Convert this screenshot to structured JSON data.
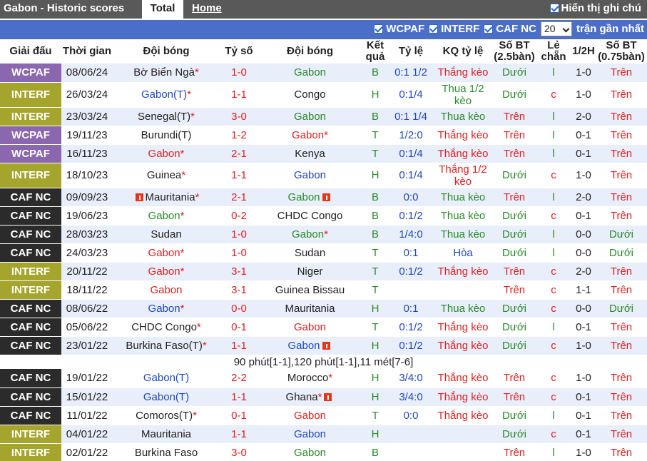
{
  "topbar": {
    "title": "Gabon - Historic scores",
    "tab_total": "Total",
    "tab_home": "Home",
    "toggle_label": "Hiển thị ghi chú"
  },
  "filters": {
    "items": [
      "WCPAF",
      "INTERF",
      "CAF NC"
    ],
    "count_value": "20",
    "recent_label": "trận gần nhất"
  },
  "columns": [
    "Giải đấu",
    "Thời gian",
    "Đội bóng",
    "Tỷ số",
    "Đội bóng",
    "Kết quả",
    "Tỷ lệ",
    "KQ tỷ lệ",
    "Số BT (2.5bàn)",
    "Lẻ chẵn",
    "1/2H",
    "Số BT (0.75bàn)"
  ],
  "colors": {
    "WCPAF": "#8b67b0",
    "INTERF": "#a5a42c",
    "CAF NC": "#2b2b2b",
    "red": "#e02020",
    "green": "#2a8a2a",
    "blue": "#1f49c0"
  },
  "rows": [
    {
      "league": "WCPAF",
      "date": "08/06/24",
      "home": "Bờ Biển Ngà",
      "home_star": true,
      "home_color": "",
      "score": "1-0",
      "away": "Gabon",
      "away_star": false,
      "away_color": "green",
      "result": "B",
      "odds": "0:1 1/2",
      "odds_result": "Thắng kèo",
      "ou": "Dưới",
      "oe": "l",
      "half": "1-0",
      "ou2": "Trên"
    },
    {
      "league": "INTERF",
      "date": "26/03/24",
      "home": "Gabon(T)",
      "home_star": true,
      "home_color": "blue",
      "score": "1-1",
      "away": "Congo",
      "away_star": false,
      "away_color": "",
      "result": "H",
      "odds": "0:1/4",
      "odds_result": "Thua 1/2 kèo",
      "ou": "Dưới",
      "oe": "c",
      "half": "1-0",
      "ou2": "Trên"
    },
    {
      "league": "INTERF",
      "date": "23/03/24",
      "home": "Senegal(T)",
      "home_star": true,
      "home_color": "",
      "score": "3-0",
      "away": "Gabon",
      "away_star": false,
      "away_color": "green",
      "result": "B",
      "odds": "0:1 1/4",
      "odds_result": "Thua kèo",
      "ou": "Trên",
      "oe": "l",
      "half": "2-0",
      "ou2": "Trên"
    },
    {
      "league": "WCPAF",
      "date": "19/11/23",
      "home": "Burundi(T)",
      "home_star": false,
      "home_color": "",
      "score": "1-2",
      "away": "Gabon",
      "away_star": true,
      "away_color": "red",
      "result": "T",
      "odds": "1/2:0",
      "odds_result": "Thắng kèo",
      "ou": "Trên",
      "oe": "l",
      "half": "0-1",
      "ou2": "Trên"
    },
    {
      "league": "WCPAF",
      "date": "16/11/23",
      "home": "Gabon",
      "home_star": true,
      "home_color": "red",
      "score": "2-1",
      "away": "Kenya",
      "away_star": false,
      "away_color": "",
      "result": "T",
      "odds": "0:1/4",
      "odds_result": "Thắng kèo",
      "ou": "Trên",
      "oe": "l",
      "half": "0-1",
      "ou2": "Trên"
    },
    {
      "league": "INTERF",
      "date": "18/10/23",
      "home": "Guinea",
      "home_star": true,
      "home_color": "",
      "score": "1-1",
      "away": "Gabon",
      "away_star": false,
      "away_color": "blue",
      "result": "H",
      "odds": "0:1/4",
      "odds_result": "Thắng 1/2 kèo",
      "ou": "Dưới",
      "oe": "c",
      "half": "1-0",
      "ou2": "Trên"
    },
    {
      "league": "CAF NC",
      "date": "09/09/23",
      "home": "Mauritania",
      "home_star": true,
      "home_color": "",
      "home_flag": true,
      "score": "2-1",
      "away": "Gabon",
      "away_star": false,
      "away_color": "green",
      "away_flag": true,
      "result": "B",
      "odds": "0:0",
      "odds_result": "Thua kèo",
      "ou": "Trên",
      "oe": "l",
      "half": "2-0",
      "ou2": "Trên"
    },
    {
      "league": "CAF NC",
      "date": "19/06/23",
      "home": "Gabon",
      "home_star": true,
      "home_color": "green",
      "score": "0-2",
      "away": "CHDC Congo",
      "away_star": false,
      "away_color": "",
      "result": "B",
      "odds": "0:1/2",
      "odds_result": "Thua kèo",
      "ou": "Dưới",
      "oe": "c",
      "half": "0-1",
      "ou2": "Trên"
    },
    {
      "league": "CAF NC",
      "date": "28/03/23",
      "home": "Sudan",
      "home_star": false,
      "home_color": "",
      "score": "1-0",
      "away": "Gabon",
      "away_star": true,
      "away_color": "green",
      "result": "B",
      "odds": "1/4:0",
      "odds_result": "Thua kèo",
      "ou": "Dưới",
      "oe": "l",
      "half": "0-0",
      "ou2": "Dưới"
    },
    {
      "league": "CAF NC",
      "date": "24/03/23",
      "home": "Gabon",
      "home_star": true,
      "home_color": "red",
      "score": "1-0",
      "away": "Sudan",
      "away_star": false,
      "away_color": "",
      "result": "T",
      "odds": "0:1",
      "odds_result": "Hòa",
      "ou": "Dưới",
      "oe": "l",
      "half": "0-0",
      "ou2": "Dưới"
    },
    {
      "league": "INTERF",
      "date": "20/11/22",
      "home": "Gabon",
      "home_star": true,
      "home_color": "red",
      "score": "3-1",
      "away": "Niger",
      "away_star": false,
      "away_color": "",
      "result": "T",
      "odds": "0:1/2",
      "odds_result": "Thắng kèo",
      "ou": "Trên",
      "oe": "c",
      "half": "2-0",
      "ou2": "Trên"
    },
    {
      "league": "INTERF",
      "date": "18/11/22",
      "home": "Gabon",
      "home_star": false,
      "home_color": "red",
      "score": "3-1",
      "away": "Guinea Bissau",
      "away_star": false,
      "away_color": "",
      "result": "T",
      "odds": "",
      "odds_result": "",
      "ou": "Trên",
      "oe": "c",
      "half": "1-1",
      "ou2": "Trên"
    },
    {
      "league": "CAF NC",
      "date": "08/06/22",
      "home": "Gabon",
      "home_star": true,
      "home_color": "blue",
      "score": "0-0",
      "away": "Mauritania",
      "away_star": false,
      "away_color": "",
      "result": "H",
      "odds": "0:1",
      "odds_result": "Thua kèo",
      "ou": "Dưới",
      "oe": "c",
      "half": "0-0",
      "ou2": "Dưới"
    },
    {
      "league": "CAF NC",
      "date": "05/06/22",
      "home": "CHDC Congo",
      "home_star": true,
      "home_color": "",
      "score": "0-1",
      "away": "Gabon",
      "away_star": false,
      "away_color": "red",
      "result": "T",
      "odds": "0:1/2",
      "odds_result": "Thắng kèo",
      "ou": "Dưới",
      "oe": "l",
      "half": "0-1",
      "ou2": "Trên"
    },
    {
      "league": "CAF NC",
      "date": "23/01/22",
      "home": "Burkina Faso(T)",
      "home_star": true,
      "home_color": "",
      "score": "1-1",
      "away": "Gabon",
      "away_star": false,
      "away_color": "blue",
      "away_flag": true,
      "result": "H",
      "odds": "0:1/2",
      "odds_result": "Thắng kèo",
      "ou": "Dưới",
      "oe": "c",
      "half": "1-0",
      "ou2": "Trên"
    },
    {
      "note": "90 phút[1-1],120 phút[1-1],11 mét[7-6]"
    },
    {
      "league": "CAF NC",
      "date": "19/01/22",
      "home": "Gabon(T)",
      "home_star": false,
      "home_color": "blue",
      "score": "2-2",
      "away": "Morocco",
      "away_star": true,
      "away_color": "",
      "result": "H",
      "odds": "3/4:0",
      "odds_result": "Thắng kèo",
      "ou": "Trên",
      "oe": "c",
      "half": "1-0",
      "ou2": "Trên"
    },
    {
      "league": "CAF NC",
      "date": "15/01/22",
      "home": "Gabon(T)",
      "home_star": false,
      "home_color": "blue",
      "score": "1-1",
      "away": "Ghana",
      "away_star": true,
      "away_color": "",
      "away_flag": true,
      "result": "H",
      "odds": "3/4:0",
      "odds_result": "Thắng kèo",
      "ou": "Trên",
      "oe": "c",
      "half": "0-1",
      "ou2": "Trên"
    },
    {
      "league": "CAF NC",
      "date": "11/01/22",
      "home": "Comoros(T)",
      "home_star": true,
      "home_color": "",
      "score": "0-1",
      "away": "Gabon",
      "away_star": false,
      "away_color": "red",
      "result": "T",
      "odds": "0:0",
      "odds_result": "Thắng kèo",
      "ou": "Dưới",
      "oe": "l",
      "half": "0-1",
      "ou2": "Trên"
    },
    {
      "league": "INTERF",
      "date": "04/01/22",
      "home": "Mauritania",
      "home_star": false,
      "home_color": "",
      "score": "1-1",
      "away": "Gabon",
      "away_star": false,
      "away_color": "blue",
      "result": "H",
      "odds": "",
      "odds_result": "",
      "ou": "Dưới",
      "oe": "c",
      "half": "0-1",
      "ou2": "Trên"
    },
    {
      "league": "INTERF",
      "date": "02/01/22",
      "home": "Burkina Faso",
      "home_star": false,
      "home_color": "",
      "score": "3-0",
      "away": "Gabon",
      "away_star": false,
      "away_color": "green",
      "result": "B",
      "odds": "",
      "odds_result": "",
      "ou": "Trên",
      "oe": "l",
      "half": "1-0",
      "ou2": "Trên"
    }
  ]
}
